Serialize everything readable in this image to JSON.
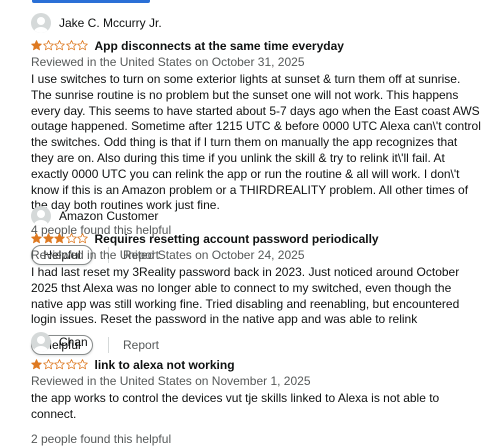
{
  "colors": {
    "star_fill": "#de7921",
    "star_stroke": "#de7921",
    "avatar": "#d5d9d9",
    "muted_text": "#565959"
  },
  "reviews": [
    {
      "author": "Jake C. Mccurry Jr.",
      "rating": 1,
      "title": "App disconnects at the same time everyday",
      "meta": "Reviewed in the United States on October 31, 2025",
      "body": "I use switches to turn on some exterior lights at sunset & turn them off at sunrise. The sunrise routine is no problem but the sunset one will not work. This happens every day. This seems to have started about 5-7 days ago when the East coast AWS outage happened. Sometime after 1215 UTC & before 0000 UTC Alexa can\\'t control the switches. Odd thing is that if I turn them on manually the app recognizes that they are on. Also during this time if you unlink the skill & try to relink it\\'ll fail. At exactly 0000 UTC you can relink the app or run the routine & all will work. I don\\'t know if this is an Amazon problem or a THIRDREALITY problem. All other times of the day both routines work just fine.",
      "helpful_count": "4 people found this helpful",
      "helpful_label": "Helpful",
      "report_label": "Report"
    },
    {
      "author": "Amazon Customer",
      "rating": 3,
      "title": "Requires resetting account password periodically",
      "meta": "Reviewed in the United States on October 24, 2025",
      "body": "I had last reset my 3Reality password back in 2023. Just noticed around October 2025 thst Alexa was no longer able to connect to my switched, even though the native app was still working fine. Tried disabling and reenabling, but encountered login issues. Reset the password in the native app and was able to relink",
      "helpful_label": "Helpful",
      "report_label": "Report"
    },
    {
      "author": "Chan",
      "rating": 1,
      "title": "link to alexa not working",
      "meta": "Reviewed in the United States on November 1, 2025",
      "body": "the app works to control the devices vut tje skills linked to Alexa is not able to connect.",
      "helpful_count": "2 people found this helpful"
    }
  ]
}
